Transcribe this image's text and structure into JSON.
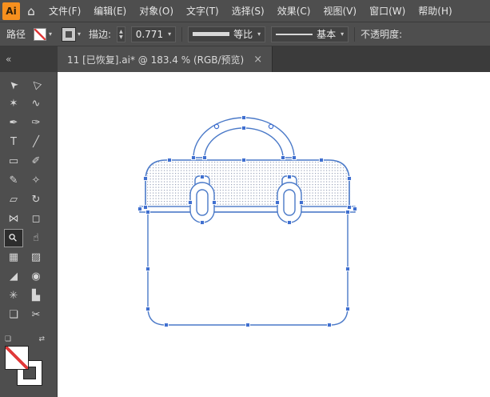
{
  "app": {
    "logo_text": "Ai",
    "home_glyph": "⌂"
  },
  "menu": {
    "items": [
      {
        "id": "file",
        "label": "文件(F)"
      },
      {
        "id": "edit",
        "label": "编辑(E)"
      },
      {
        "id": "object",
        "label": "对象(O)"
      },
      {
        "id": "type",
        "label": "文字(T)"
      },
      {
        "id": "select",
        "label": "选择(S)"
      },
      {
        "id": "effect",
        "label": "效果(C)"
      },
      {
        "id": "view",
        "label": "视图(V)"
      },
      {
        "id": "window",
        "label": "窗口(W)"
      },
      {
        "id": "help",
        "label": "帮助(H)"
      }
    ]
  },
  "control_bar": {
    "selection_label": "路径",
    "stroke_label": "描边:",
    "stroke_weight": "0.771",
    "width_profile": "等比",
    "brush_definition": "基本",
    "opacity_label": "不透明度:",
    "dropdown_glyph": "▾",
    "stepper_up_glyph": "▲",
    "stepper_down_glyph": "▼"
  },
  "tab": {
    "title": "11 [已恢复].ai* @ 183.4 % (RGB/预览)",
    "close_glyph": "×"
  },
  "toolbar": {
    "collapse_glyph": "«",
    "selected_tool": "zoom-tool",
    "default_swatch_glyph": "❏",
    "swap_swatch_glyph": "⇄",
    "tools": [
      {
        "name": "selection-tool",
        "glyph": "➤"
      },
      {
        "name": "direct-selection-tool",
        "glyph": "▷"
      },
      {
        "name": "magic-wand-tool",
        "glyph": "✶"
      },
      {
        "name": "lasso-tool",
        "glyph": "∿"
      },
      {
        "name": "pen-tool",
        "glyph": "✒"
      },
      {
        "name": "curvature-tool",
        "glyph": "✑"
      },
      {
        "name": "type-tool",
        "glyph": "T"
      },
      {
        "name": "line-segment-tool",
        "glyph": "╱"
      },
      {
        "name": "rectangle-tool",
        "glyph": "▭"
      },
      {
        "name": "paintbrush-tool",
        "glyph": "✐"
      },
      {
        "name": "pencil-tool",
        "glyph": "✎"
      },
      {
        "name": "shaper-tool",
        "glyph": "✧"
      },
      {
        "name": "eraser-tool",
        "glyph": "▱"
      },
      {
        "name": "rotate-tool",
        "glyph": "↻"
      },
      {
        "name": "width-tool",
        "glyph": "⋈"
      },
      {
        "name": "free-transform-tool",
        "glyph": "◻"
      },
      {
        "name": "zoom-tool",
        "glyph": "⚲",
        "selected": true
      },
      {
        "name": "hand-tool",
        "glyph": "☝"
      },
      {
        "name": "mesh-tool",
        "glyph": "▦"
      },
      {
        "name": "gradient-tool",
        "glyph": "▨"
      },
      {
        "name": "eyedropper-tool",
        "glyph": "◢"
      },
      {
        "name": "blend-tool",
        "glyph": "◉"
      },
      {
        "name": "symbol-sprayer-tool",
        "glyph": "✳"
      },
      {
        "name": "column-graph-tool",
        "glyph": "▙"
      },
      {
        "name": "artboard-tool",
        "glyph": "❏"
      },
      {
        "name": "slice-tool",
        "glyph": "✂"
      }
    ]
  },
  "artwork": {
    "description": "Outlined briefcase illustration: arched handle, dotted-pattern lid, rim band, rounded body and two oval clasps; path selected showing blue anchor points"
  },
  "colors": {
    "artwork-stroke": "#4a79c8",
    "selection": "#3f6fd0",
    "ai-orange": "#f7901e",
    "pattern-dot": "#9aa3ba"
  }
}
